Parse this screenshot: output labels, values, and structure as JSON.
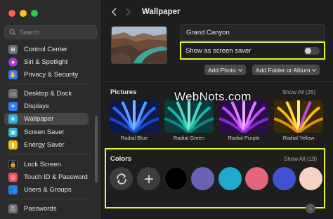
{
  "window": {
    "traffic_colors": [
      "#fe5f57",
      "#febc2e",
      "#28c840"
    ]
  },
  "sidebar": {
    "search_placeholder": "Search",
    "items": [
      {
        "label": "Control Center",
        "icon": "control-center-icon",
        "color": "#6e6e73"
      },
      {
        "label": "Siri & Spotlight",
        "icon": "siri-icon",
        "color": "#b14bdc"
      },
      {
        "label": "Privacy & Security",
        "icon": "hand-icon",
        "color": "#2f7cf6"
      },
      {
        "label": "Desktop & Dock",
        "icon": "dock-icon",
        "color": "#6e6e73"
      },
      {
        "label": "Displays",
        "icon": "display-icon",
        "color": "#2f7cf6"
      },
      {
        "label": "Wallpaper",
        "icon": "wallpaper-icon",
        "color": "#26b5e8",
        "active": true
      },
      {
        "label": "Screen Saver",
        "icon": "screen-saver-icon",
        "color": "#2fb1d8"
      },
      {
        "label": "Energy Saver",
        "icon": "energy-icon",
        "color": "#f2b91a"
      },
      {
        "label": "Lock Screen",
        "icon": "lock-icon",
        "color": "#1c1c1e"
      },
      {
        "label": "Touch ID & Password",
        "icon": "fingerprint-icon",
        "color": "#ef4c5a"
      },
      {
        "label": "Users & Groups",
        "icon": "users-icon",
        "color": "#2f7cf6"
      },
      {
        "label": "Passwords",
        "icon": "key-icon",
        "color": "#6e6e73"
      }
    ]
  },
  "header": {
    "title": "Wallpaper"
  },
  "current": {
    "name": "Grand Canyon",
    "screen_saver_label": "Show as screen saver",
    "screen_saver_on": false,
    "add_photo": "Add Photo",
    "add_folder": "Add Folder or Album"
  },
  "pictures": {
    "title": "Pictures",
    "show_all": "Show All (25)",
    "items": [
      {
        "caption": "Radial Blue"
      },
      {
        "caption": "Radial Green"
      },
      {
        "caption": "Radial Purple"
      },
      {
        "caption": "Radial Yellow"
      }
    ]
  },
  "watermark": "WebNots.com",
  "colors": {
    "title": "Colors",
    "show_all": "Show All (19)",
    "swatches": [
      "#000000",
      "#6a63b5",
      "#1eaacb",
      "#e46679",
      "#4251d0",
      "#f6d2c2"
    ]
  }
}
